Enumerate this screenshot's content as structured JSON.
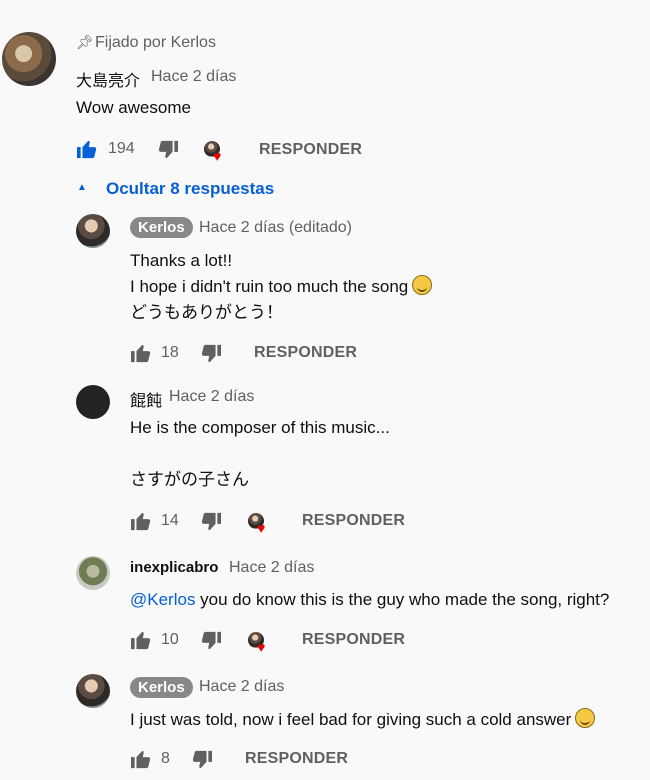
{
  "pinned": {
    "pin_label": "Fijado por Kerlos",
    "author": "大島亮介",
    "time": "Hace 2 días",
    "text": "Wow awesome",
    "likes": "194",
    "reply_label": "RESPONDER"
  },
  "replies_toggle": {
    "label": "Ocultar 8 respuestas"
  },
  "replies": [
    {
      "author": "Kerlos",
      "time": "Hace 2 días (editado)",
      "lines": [
        "Thanks a lot!!",
        "I hope i didn't ruin too much the song",
        "どうもありがとう！"
      ],
      "likes": "18",
      "reply_label": "RESPONDER"
    },
    {
      "author": "餛飩",
      "time": "Hace 2 días",
      "lines": [
        "He is the composer of this music...",
        "さすがの子さん"
      ],
      "likes": "14",
      "reply_label": "RESPONDER"
    },
    {
      "author": "inexplicabro",
      "time": "Hace 2 días",
      "mention": "@Kerlos",
      "text": " you do know this is the guy who made the song, right?",
      "likes": "10",
      "reply_label": "RESPONDER"
    },
    {
      "author": "Kerlos",
      "time": "Hace 2 días",
      "lines": [
        "I just was told, now i feel bad for giving such a cold answer"
      ],
      "likes": "8",
      "reply_label": "RESPONDER"
    }
  ],
  "colors": {
    "link": "#065fd4",
    "like_active": "#065fd4",
    "heart": "#ee0000",
    "muted": "#606060"
  }
}
